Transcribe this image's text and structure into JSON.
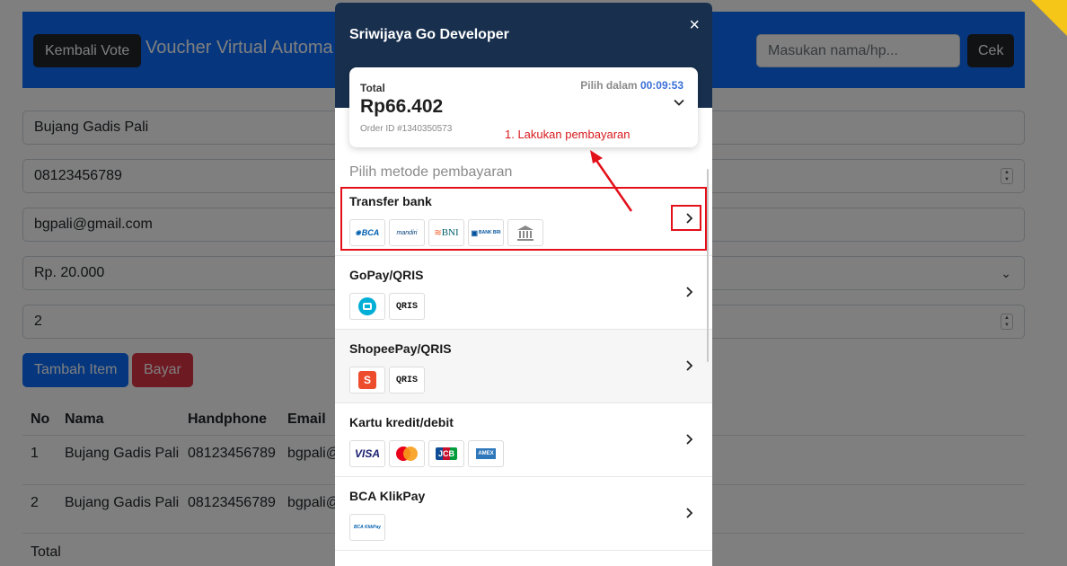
{
  "background": {
    "back_button": "Kembali Vote",
    "brand": "Voucher Virtual Automa",
    "search_placeholder": "Masukan nama/hp...",
    "cek_button": "Cek",
    "fields": {
      "name": "Bujang Gadis Pali",
      "phone": "08123456789",
      "email": "bgpali@gmail.com",
      "amount": "Rp. 20.000",
      "quantity": "2"
    },
    "add_item_button": "Tambah Item",
    "pay_button": "Bayar",
    "table": {
      "headers": [
        "No",
        "Nama",
        "Handphone",
        "Email"
      ],
      "rows": [
        [
          "1",
          "Bujang Gadis Pali",
          "08123456789",
          "bgpali@"
        ],
        [
          "2",
          "Bujang Gadis Pali",
          "08123456789",
          "bgpali@"
        ]
      ],
      "total_label": "Total"
    }
  },
  "modal": {
    "title": "Sriwijaya Go Developer",
    "close": "×",
    "total_label": "Total",
    "total_amount": "Rp66.402",
    "order_id": "Order ID #1340350573",
    "pilih_dalam": "Pilih dalam",
    "timer": "00:09:53",
    "section_title": "Pilih metode pembayaran",
    "methods": [
      {
        "name": "Transfer bank",
        "logos": [
          "BCA",
          "mandiri",
          "BNI",
          "BANK BRI",
          "bank-icon"
        ]
      },
      {
        "name": "GoPay/QRIS",
        "logos": [
          "gopay-icon",
          "QRIS"
        ]
      },
      {
        "name": "ShopeePay/QRIS",
        "logos": [
          "shopeepay-icon",
          "QRIS"
        ]
      },
      {
        "name": "Kartu kredit/debit",
        "logos": [
          "VISA",
          "mastercard-icon",
          "JCB",
          "AMEX"
        ]
      },
      {
        "name": "BCA KlikPay",
        "logos": [
          "BCA KlikPay"
        ]
      }
    ]
  },
  "annotation": {
    "text": "1. Lakukan pembayaran",
    "color": "#d7191c"
  },
  "colors": {
    "navbar": "#0d6efd",
    "modal_header": "#18304e",
    "danger": "#dc3545",
    "timer": "#3a6fd8"
  }
}
